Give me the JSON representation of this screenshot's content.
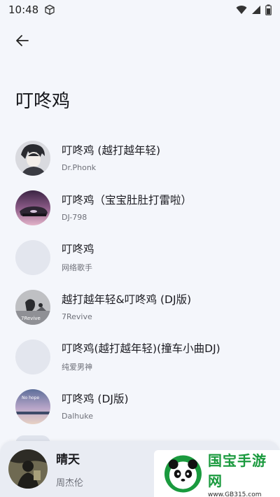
{
  "status": {
    "time": "10:48"
  },
  "header": {
    "title": "叮咚鸡"
  },
  "songs": [
    {
      "title": "叮咚鸡 (越打越年轻)",
      "artist": "Dr.Phonk"
    },
    {
      "title": "叮咚鸡（宝宝肚肚打雷啦）",
      "artist": "DJ-798"
    },
    {
      "title": "叮咚鸡",
      "artist": "网络歌手"
    },
    {
      "title": "越打越年轻&叮咚鸡 (DJ版)",
      "artist": "7Revive"
    },
    {
      "title": "叮咚鸡(越打越年轻)(撞车小曲DJ)",
      "artist": "纯爱男神"
    },
    {
      "title": "叮咚鸡 (DJ版)",
      "artist": "Dalhuke"
    }
  ],
  "cover_texts": {
    "song4": "7Revive",
    "song6": "No hope"
  },
  "player": {
    "title": "晴天",
    "artist": "周杰伦"
  },
  "watermark": {
    "name": "国宝手游网",
    "url": "www.GB315.com"
  }
}
